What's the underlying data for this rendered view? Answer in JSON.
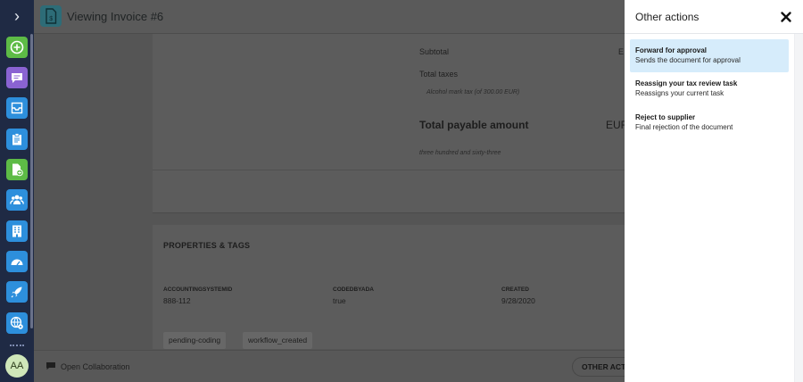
{
  "page": {
    "title": "Viewing Invoice #6"
  },
  "rail": {
    "items": [
      {
        "name": "add-icon",
        "color": "#5dbb46"
      },
      {
        "name": "chat-icon",
        "color": "#8a63d2"
      },
      {
        "name": "inbox-icon",
        "color": "#2d8fdc"
      },
      {
        "name": "clipboard-icon",
        "color": "#2d8fdc"
      },
      {
        "name": "add-document-icon",
        "color": "#5dbb46"
      },
      {
        "name": "users-icon",
        "color": "#2d8fdc"
      },
      {
        "name": "building-icon",
        "color": "#2d8fdc"
      },
      {
        "name": "dashboard-icon",
        "color": "#2d8fdc"
      },
      {
        "name": "rocket-icon",
        "color": "#2d8fdc"
      },
      {
        "name": "globe-settings-icon",
        "color": "#2d8fdc"
      }
    ],
    "avatar_initials": "AA"
  },
  "totals": {
    "subtotal_label": "Subtotal",
    "subtotal_currency": "E",
    "total_taxes_label": "Total taxes",
    "tax_line": "Alcohol mark tax (of 300.00 EUR)",
    "total_payable_label": "Total payable amount",
    "total_payable_currency": "EUR",
    "amount_in_words": "three hundred and sixty-three"
  },
  "properties": {
    "heading": "PROPERTIES & TAGS",
    "fields": [
      {
        "key": "ACCOUNTINGSYSTEMID",
        "value": "888-112"
      },
      {
        "key": "CODEDBYADA",
        "value": "true"
      },
      {
        "key": "CREATED",
        "value": "9/28/2020"
      }
    ],
    "tags": [
      "pending-coding",
      "workflow_created"
    ]
  },
  "bottombar": {
    "collaboration_label": "Open Collaboration",
    "other_actions_label": "OTHER ACTIONS"
  },
  "panel": {
    "title": "Other actions",
    "actions": [
      {
        "title": "Forward for approval",
        "description": "Sends the document for approval",
        "active": true
      },
      {
        "title": "Reassign your tax review task",
        "description": "Reassigns your current task",
        "active": false
      },
      {
        "title": "Reject to supplier",
        "description": "Final rejection of the document",
        "active": false
      }
    ]
  },
  "colors": {
    "rail_bg": "#1f2a44",
    "active_action_bg": "#d6ecfb",
    "green": "#5dbb46",
    "blue": "#2d8fdc",
    "purple": "#8a63d2"
  }
}
